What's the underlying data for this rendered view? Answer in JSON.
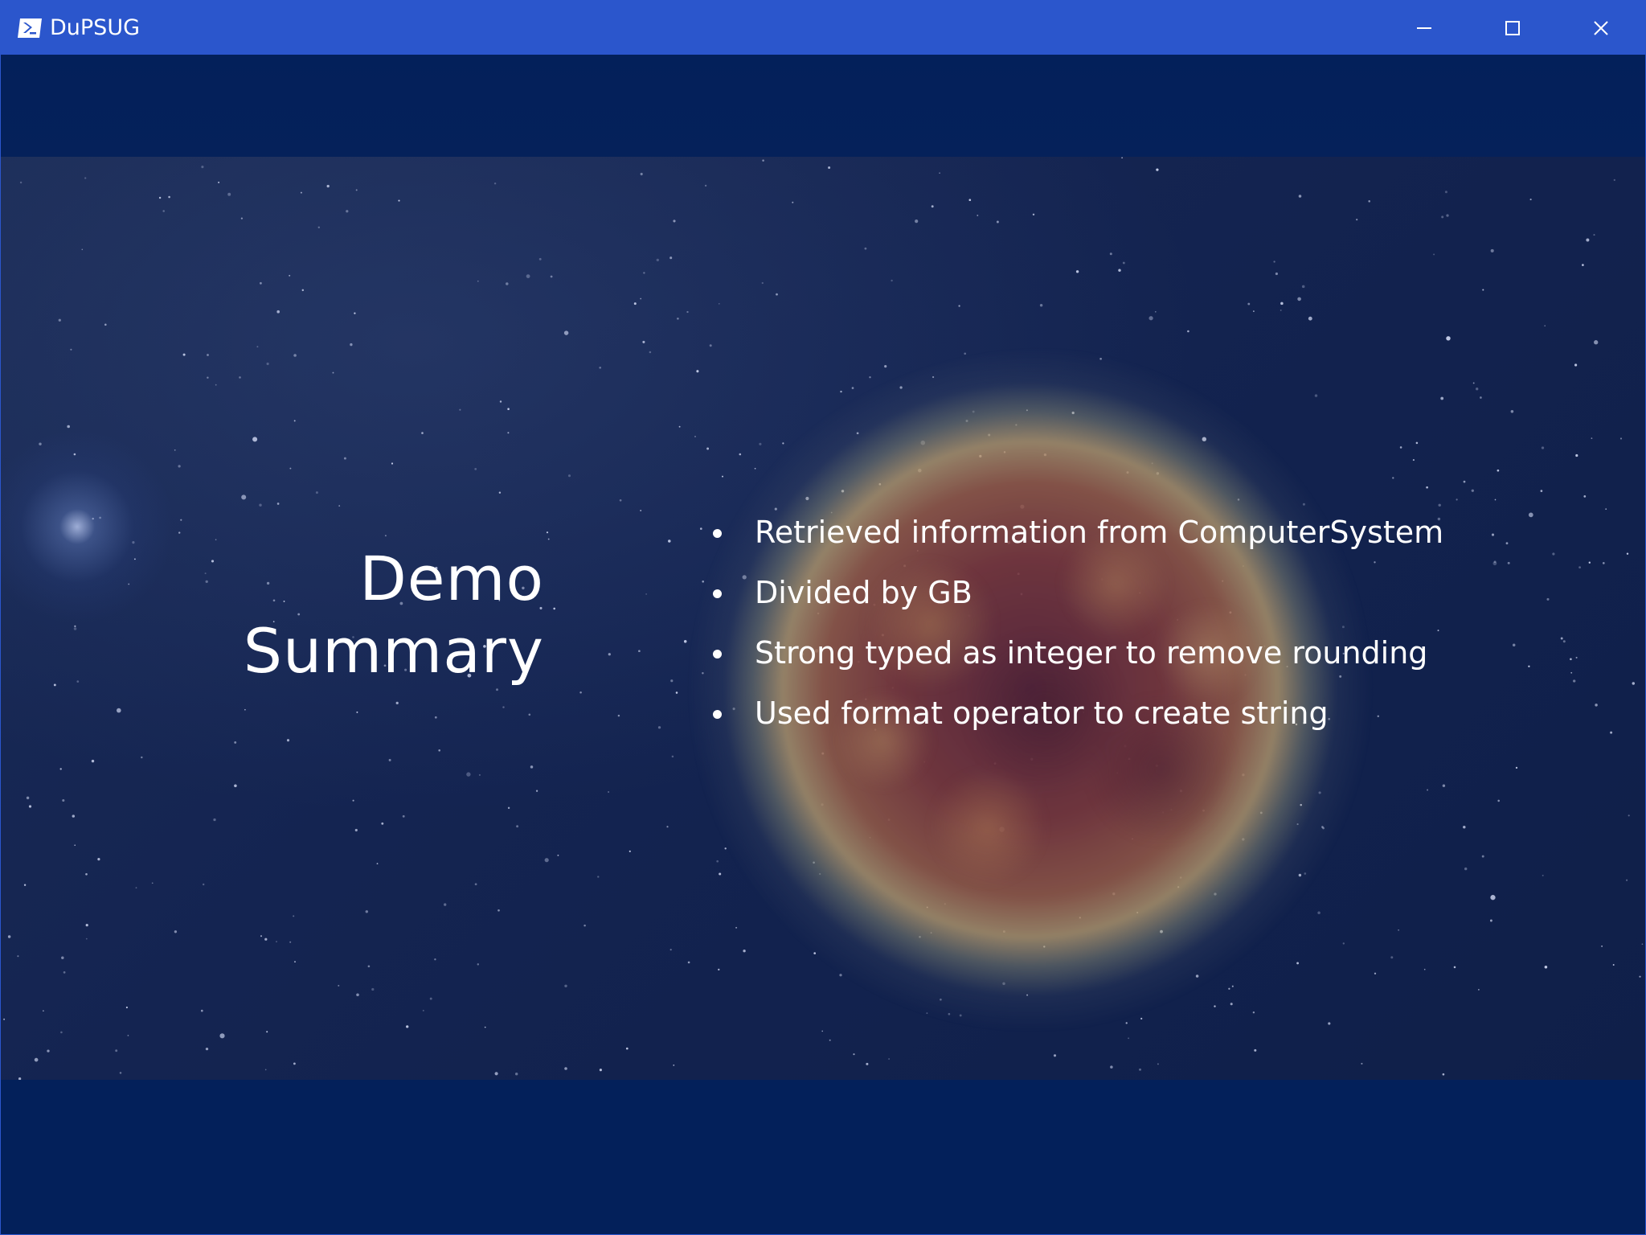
{
  "window": {
    "title": "DuPSUG",
    "app_icon": "powershell-icon",
    "controls": {
      "minimize_icon": "minimize-icon",
      "maximize_icon": "maximize-icon",
      "close_icon": "close-icon"
    },
    "titlebar_color": "#2B56CC"
  },
  "slide": {
    "title_line1": "Demo",
    "title_line2": "Summary",
    "bullets": [
      "Retrieved information from ComputerSystem",
      "Divided by GB",
      "Strong typed as integer to remove rounding",
      "Used format operator to create string"
    ],
    "background_color": "#03205A",
    "text_color": "#FFFFFF"
  }
}
